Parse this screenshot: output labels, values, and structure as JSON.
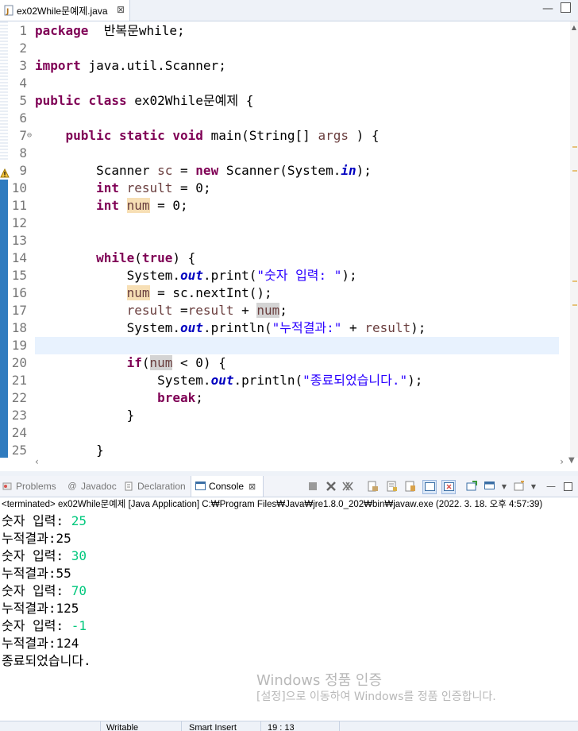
{
  "editor": {
    "tab_label": "ex02While문예제.java",
    "tab_close": "⊠",
    "lines": [
      {
        "n": "1",
        "parts": [
          [
            "kw",
            "package"
          ],
          [
            "",
            "  반복문while;"
          ]
        ]
      },
      {
        "n": "2",
        "parts": []
      },
      {
        "n": "3",
        "parts": [
          [
            "kw",
            "import"
          ],
          [
            "",
            " java.util.Scanner;"
          ]
        ]
      },
      {
        "n": "4",
        "parts": []
      },
      {
        "n": "5",
        "parts": [
          [
            "kw",
            "public"
          ],
          [
            "",
            " "
          ],
          [
            "kw",
            "class"
          ],
          [
            "",
            " ex02While문예제 {"
          ]
        ]
      },
      {
        "n": "6",
        "parts": []
      },
      {
        "n": "7",
        "parts": [
          [
            "",
            "    "
          ],
          [
            "kw",
            "public"
          ],
          [
            "",
            " "
          ],
          [
            "kw",
            "static"
          ],
          [
            "",
            " "
          ],
          [
            "kw",
            "void"
          ],
          [
            "",
            " main(String[] "
          ],
          [
            "var",
            "args"
          ],
          [
            "",
            " ) {"
          ]
        ]
      },
      {
        "n": "8",
        "parts": []
      },
      {
        "n": "9",
        "parts": [
          [
            "",
            "        Scanner "
          ],
          [
            "var",
            "sc"
          ],
          [
            "",
            " = "
          ],
          [
            "kw",
            "new"
          ],
          [
            "",
            " Scanner(System."
          ],
          [
            "fld",
            "in"
          ],
          [
            "",
            ");"
          ]
        ]
      },
      {
        "n": "10",
        "parts": [
          [
            "",
            "        "
          ],
          [
            "kw",
            "int"
          ],
          [
            "",
            " "
          ],
          [
            "var",
            "result"
          ],
          [
            "",
            " = 0;"
          ]
        ]
      },
      {
        "n": "11",
        "parts": [
          [
            "",
            "        "
          ],
          [
            "kw",
            "int"
          ],
          [
            "",
            " "
          ],
          [
            "var hl",
            "num"
          ],
          [
            "",
            " = 0;"
          ]
        ]
      },
      {
        "n": "12",
        "parts": []
      },
      {
        "n": "13",
        "parts": []
      },
      {
        "n": "14",
        "parts": [
          [
            "",
            "        "
          ],
          [
            "kw",
            "while"
          ],
          [
            "",
            "("
          ],
          [
            "kw",
            "true"
          ],
          [
            "",
            ") {"
          ]
        ]
      },
      {
        "n": "15",
        "parts": [
          [
            "",
            "            System."
          ],
          [
            "fld",
            "out"
          ],
          [
            "",
            ".print("
          ],
          [
            "str",
            "\"숫자 입력: \""
          ],
          [
            "",
            ");"
          ]
        ]
      },
      {
        "n": "16",
        "parts": [
          [
            "",
            "            "
          ],
          [
            "var hl",
            "num"
          ],
          [
            "",
            " = sc.nextInt();"
          ]
        ]
      },
      {
        "n": "17",
        "parts": [
          [
            "",
            "            "
          ],
          [
            "var",
            "result"
          ],
          [
            "",
            " ="
          ],
          [
            "var",
            "result"
          ],
          [
            "",
            " + "
          ],
          [
            "var hl2",
            "num"
          ],
          [
            "",
            ";"
          ]
        ]
      },
      {
        "n": "18",
        "parts": [
          [
            "",
            "            System."
          ],
          [
            "fld",
            "out"
          ],
          [
            "",
            ".println("
          ],
          [
            "str",
            "\"누적결과:\""
          ],
          [
            "",
            " + "
          ],
          [
            "var",
            "result"
          ],
          [
            "",
            ");"
          ]
        ]
      },
      {
        "n": "19",
        "parts": []
      },
      {
        "n": "20",
        "parts": [
          [
            "",
            "            "
          ],
          [
            "kw",
            "if"
          ],
          [
            "",
            "("
          ],
          [
            "var hl2",
            "num"
          ],
          [
            "",
            " < 0) {"
          ]
        ]
      },
      {
        "n": "21",
        "parts": [
          [
            "",
            "                System."
          ],
          [
            "fld",
            "out"
          ],
          [
            "",
            ".println("
          ],
          [
            "str",
            "\"종료되었습니다.\""
          ],
          [
            "",
            ");"
          ]
        ]
      },
      {
        "n": "22",
        "parts": [
          [
            "",
            "                "
          ],
          [
            "kw",
            "break"
          ],
          [
            "",
            ";"
          ]
        ]
      },
      {
        "n": "23",
        "parts": [
          [
            "",
            "            }"
          ]
        ]
      },
      {
        "n": "24",
        "parts": []
      },
      {
        "n": "25",
        "parts": [
          [
            "",
            "        }"
          ]
        ]
      }
    ]
  },
  "views": {
    "problems": "Problems",
    "javadoc": "Javadoc",
    "declaration": "Declaration",
    "console": "Console"
  },
  "console": {
    "terminated": "<terminated> ex02While문예제 [Java Application] C:₩Program Files₩Java₩jre1.8.0_202₩bin₩javaw.exe (2022. 3. 18. 오후 4:57:39)",
    "output": [
      {
        "text": "숫자 입력: ",
        "input": "25"
      },
      {
        "text": "누적결과:25",
        "input": ""
      },
      {
        "text": "숫자 입력: ",
        "input": "30"
      },
      {
        "text": "누적결과:55",
        "input": ""
      },
      {
        "text": "숫자 입력: ",
        "input": "70"
      },
      {
        "text": "누적결과:125",
        "input": ""
      },
      {
        "text": "숫자 입력: ",
        "input": "-1"
      },
      {
        "text": "누적결과:124",
        "input": ""
      },
      {
        "text": "종료되었습니다.",
        "input": ""
      }
    ]
  },
  "watermark": {
    "title": "Windows 정품 인증",
    "subtitle": "[설정]으로 이동하여 Windows를 정품 인증합니다."
  },
  "status": {
    "writable": "Writable",
    "insert_mode": "Smart Insert",
    "position": "19 : 13"
  },
  "colors": {
    "keyword": "#7f0055",
    "string": "#2a00ff",
    "field": "#0000c0",
    "console_input": "#00c87d",
    "change_bar": "#2f7bbf"
  }
}
